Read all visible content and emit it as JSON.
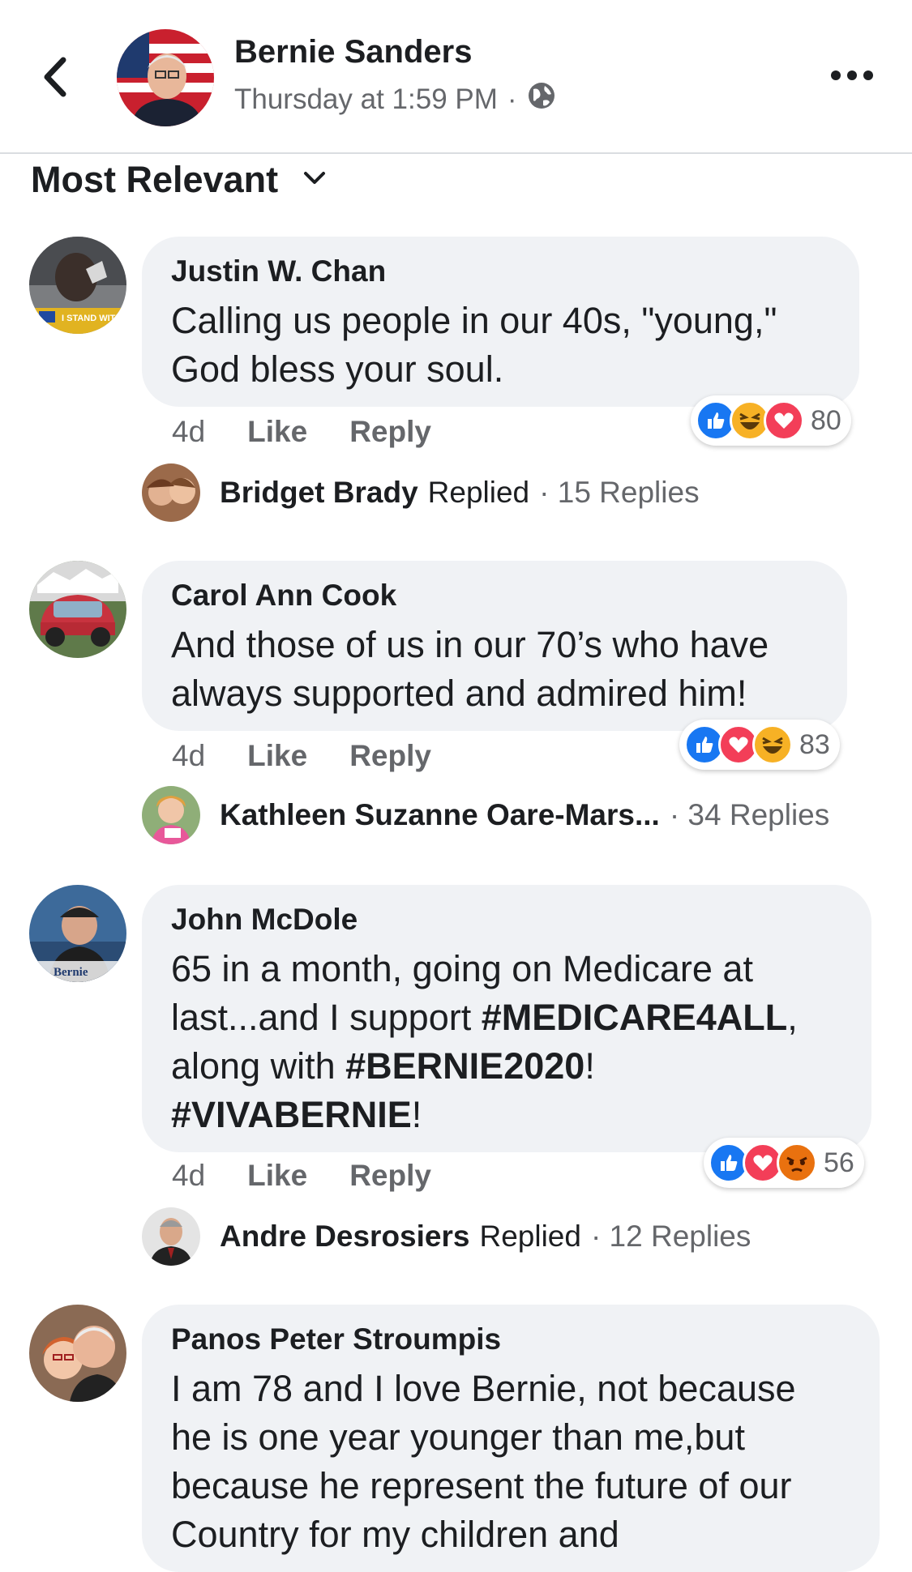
{
  "header": {
    "name": "Bernie Sanders",
    "timestamp": "Thursday at 1:59 PM",
    "separator": "·",
    "icons": [
      "back-arrow-icon",
      "globe-icon",
      "more-icon"
    ]
  },
  "sort": {
    "label": "Most Relevant",
    "icon": "chevron-down-icon"
  },
  "colors": {
    "like": "#1877f2",
    "love": "#f33e58",
    "haha": "#f7b125",
    "angry": "#e9710f",
    "bubble": "#f0f2f5",
    "meta": "#65676b"
  },
  "comments": [
    {
      "name": "Justin W. Chan",
      "text_lines": [
        "Calling us people in our 40s, \"young,\"",
        "God bless your soul."
      ],
      "time": "4d",
      "like": "Like",
      "reply": "Reply",
      "reactions": [
        "like",
        "haha",
        "love"
      ],
      "reaction_count": "80",
      "avatar_badge": "I STAND WITH",
      "reply_author": "Bridget Brady",
      "reply_verb": "Replied",
      "reply_count": "· 15 Replies"
    },
    {
      "name": "Carol Ann Cook",
      "text_lines": [
        "And those of us in our 70’s who have",
        "always supported and admired him!"
      ],
      "time": "4d",
      "like": "Like",
      "reply": "Reply",
      "reactions": [
        "like",
        "love",
        "haha"
      ],
      "reaction_count": "83",
      "reply_author": "Kathleen Suzanne Oare-Mars...",
      "reply_verb": "",
      "reply_count": "· 34 Replies"
    },
    {
      "name": "John McDole",
      "text_parts": {
        "line1": "65 in a month, going on Medicare at",
        "line2_a": "last...and I support ",
        "line2_b": "#MEDICARE4ALL",
        "line2_c": ",",
        "line3_a": "along with ",
        "line3_b": "#BERNIE2020",
        "line3_c": "!",
        "line4_a": "#VIVABERNIE",
        "line4_b": "!"
      },
      "time": "4d",
      "like": "Like",
      "reply": "Reply",
      "reactions": [
        "like",
        "love",
        "angry"
      ],
      "reaction_count": "56",
      "avatar_badge": "Bernie",
      "reply_author": "Andre Desrosiers",
      "reply_verb": "Replied",
      "reply_count": "· 12 Replies"
    },
    {
      "name": "Panos Peter Stroumpis",
      "text_lines": [
        "I am 78 and I love Bernie, not because",
        "he is one year younger than me,but",
        "because he represent the future of our",
        "Country for my children and"
      ]
    }
  ]
}
